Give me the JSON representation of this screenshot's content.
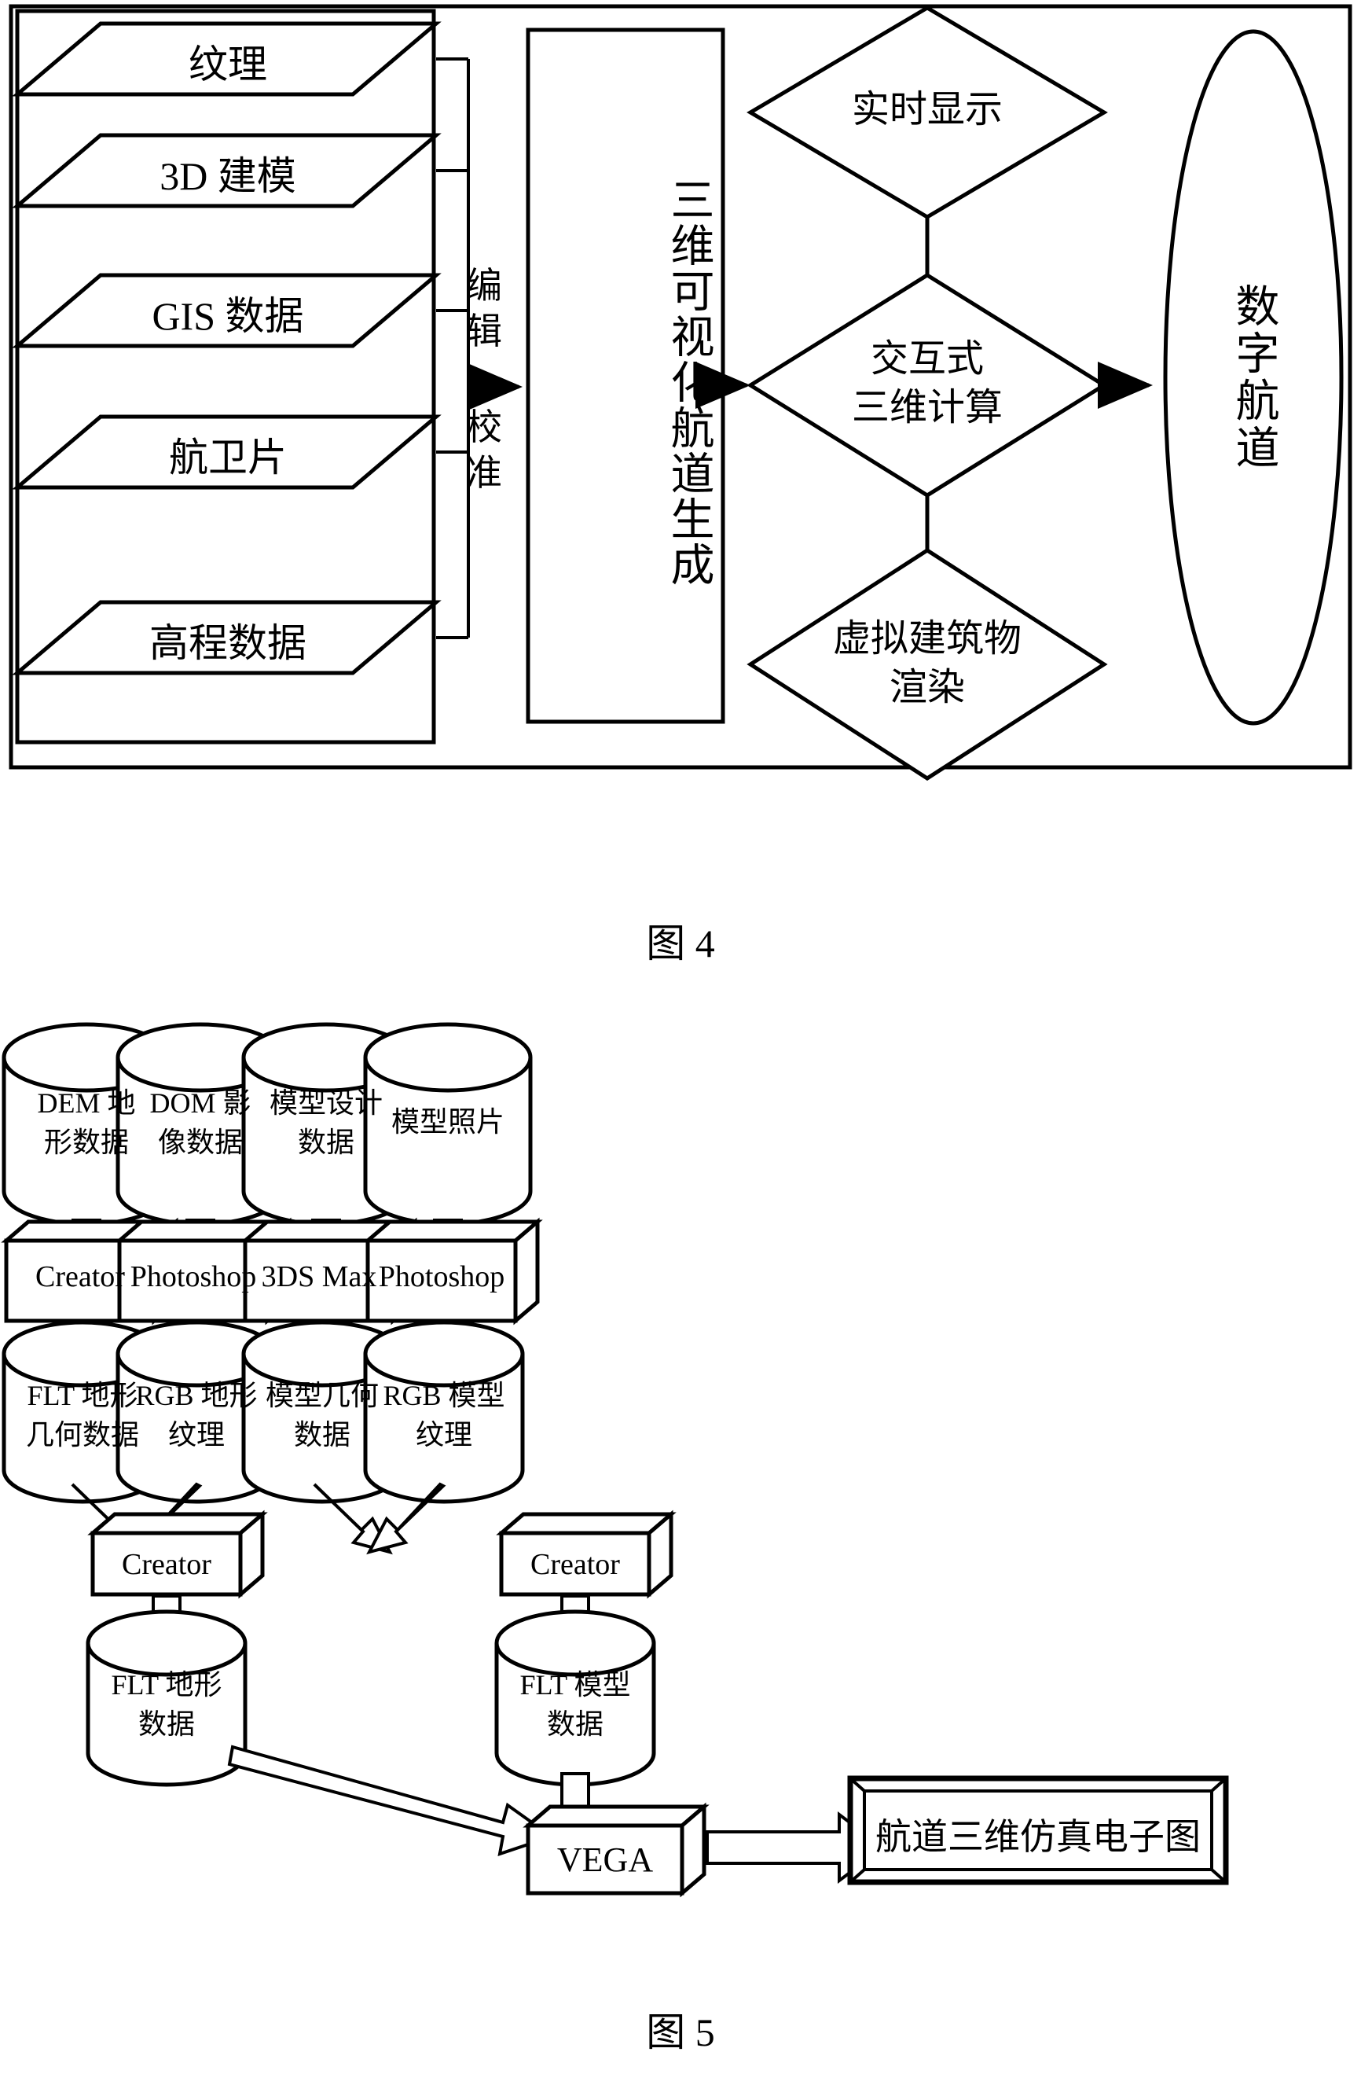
{
  "figure4": {
    "caption": "图 4",
    "inputs": [
      {
        "label": "纹理"
      },
      {
        "label": "3D 建模"
      },
      {
        "label": "GIS 数据"
      },
      {
        "label": "航卫片"
      },
      {
        "label": "高程数据"
      }
    ],
    "edge_label_top": "编辑",
    "edge_label_bottom": "校准",
    "process": "三维可视化航道生成",
    "decisions": [
      {
        "lines": [
          "实时显示"
        ]
      },
      {
        "lines": [
          "交互式",
          "三维计算"
        ]
      },
      {
        "lines": [
          "虚拟建筑物",
          "渲染"
        ]
      }
    ],
    "output": "数字航道"
  },
  "figure5": {
    "caption": "图 5",
    "sources": [
      {
        "lines": [
          "DEM 地",
          "形数据"
        ]
      },
      {
        "lines": [
          "DOM 影",
          "像数据"
        ]
      },
      {
        "lines": [
          "模型设计",
          "数据"
        ]
      },
      {
        "lines": [
          "模型照片"
        ]
      }
    ],
    "tools_row1": [
      {
        "label": "Creator"
      },
      {
        "label": "Photoshop"
      },
      {
        "label": "3DS Max"
      },
      {
        "label": "Photoshop"
      }
    ],
    "intermediates": [
      {
        "lines": [
          "FLT 地形",
          "几何数据"
        ]
      },
      {
        "lines": [
          "RGB 地形",
          "纹理"
        ]
      },
      {
        "lines": [
          "模型几何",
          "数据"
        ]
      },
      {
        "lines": [
          "RGB 模型",
          "纹理"
        ]
      }
    ],
    "tools_row2": [
      {
        "label": "Creator"
      },
      {
        "label": "Creator"
      }
    ],
    "merged": [
      {
        "lines": [
          "FLT 地形",
          "数据"
        ]
      },
      {
        "lines": [
          "FLT 模型",
          "数据"
        ]
      }
    ],
    "engine": "VEGA",
    "result": "航道三维仿真电子图"
  },
  "colors": {
    "stroke": "#000000",
    "background": "#ffffff"
  }
}
